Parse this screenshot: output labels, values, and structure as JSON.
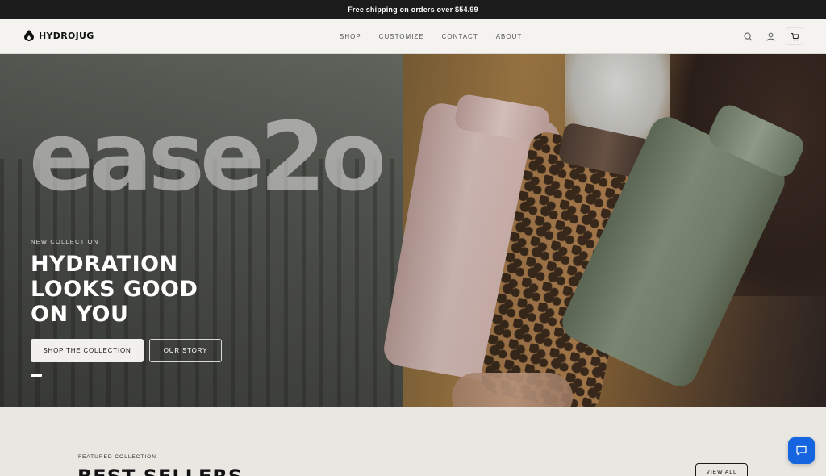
{
  "announcement": {
    "text": "Free shipping on orders over $54.99"
  },
  "header": {
    "brand": "HYDROJUG",
    "nav": [
      "SHOP",
      "CUSTOMIZE",
      "CONTACT",
      "ABOUT"
    ],
    "icons": [
      "search-icon",
      "account-icon",
      "cart-icon"
    ]
  },
  "hero": {
    "script_word": "ease2o",
    "eyebrow": "NEW COLLECTION",
    "headline": [
      "HYDRATION",
      "LOOKS GOOD",
      "ON YOU"
    ],
    "primary_cta": "SHOP THE COLLECTION",
    "secondary_cta": "OUR STORY",
    "slide_indicator": {
      "current": 1
    }
  },
  "featured": {
    "eyebrow": "FEATURED COLLECTION",
    "title": "BEST SELLERS",
    "view_all": "VIEW ALL"
  },
  "chat": {
    "icon": "chat-icon",
    "color": "#1565e0"
  },
  "colors": {
    "announcement_bg": "#1c1c1c",
    "header_bg": "#f4f3ef",
    "page_bg": "#e9e7e2"
  }
}
